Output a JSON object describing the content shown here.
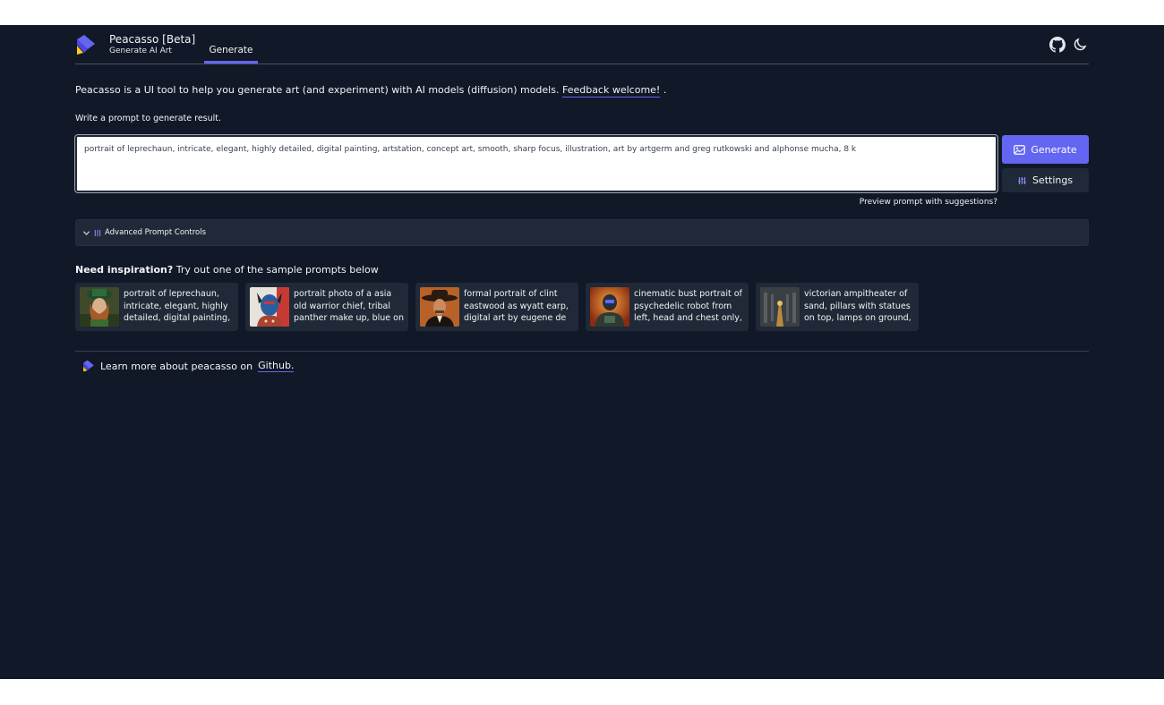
{
  "header": {
    "title": "Peacasso [Beta]",
    "subtitle": "Generate AI Art",
    "tab_generate": "Generate",
    "icons": [
      "github-icon",
      "moon-icon"
    ]
  },
  "intro": {
    "text": "Peacasso is a UI tool to help you generate art (and experiment) with AI models (diffusion) models.",
    "feedback_link": "Feedback welcome!",
    "trailing": "."
  },
  "prompt": {
    "label": "Write a prompt to generate result.",
    "value": "portrait of leprechaun, intricate, elegant, highly detailed, digital painting, artstation, concept art, smooth, sharp focus, illustration, art by artgerm and greg rutkowski and alphonse mucha, 8 k",
    "generate_label": "Generate",
    "settings_label": "Settings",
    "preview_link": "Preview prompt with suggestions?"
  },
  "advanced": {
    "label": "Advanced Prompt Controls"
  },
  "inspiration": {
    "heading": "Need inspiration?",
    "subtext": " Try out one of the sample prompts below",
    "samples": [
      {
        "text": "portrait of leprechaun, intricate, elegant, highly detailed, digital painting, artstation"
      },
      {
        "text": "portrait photo of a asia old warrior chief, tribal panther make up, blue on red, side profile"
      },
      {
        "text": "formal portrait of clint eastwood as wyatt earp, digital art by eugene de blaas"
      },
      {
        "text": "cinematic bust portrait of psychedelic robot from left, head and chest only, exotic alien features"
      },
      {
        "text": "victorian ampitheater of sand, pillars with statues on top, lamps on ground, by peter mohrbacher"
      }
    ]
  },
  "footer": {
    "text": "Learn more about peacasso on",
    "link": "Github."
  },
  "colors": {
    "background": "#111827",
    "panel": "#1f2937",
    "accent": "#6366f1"
  }
}
